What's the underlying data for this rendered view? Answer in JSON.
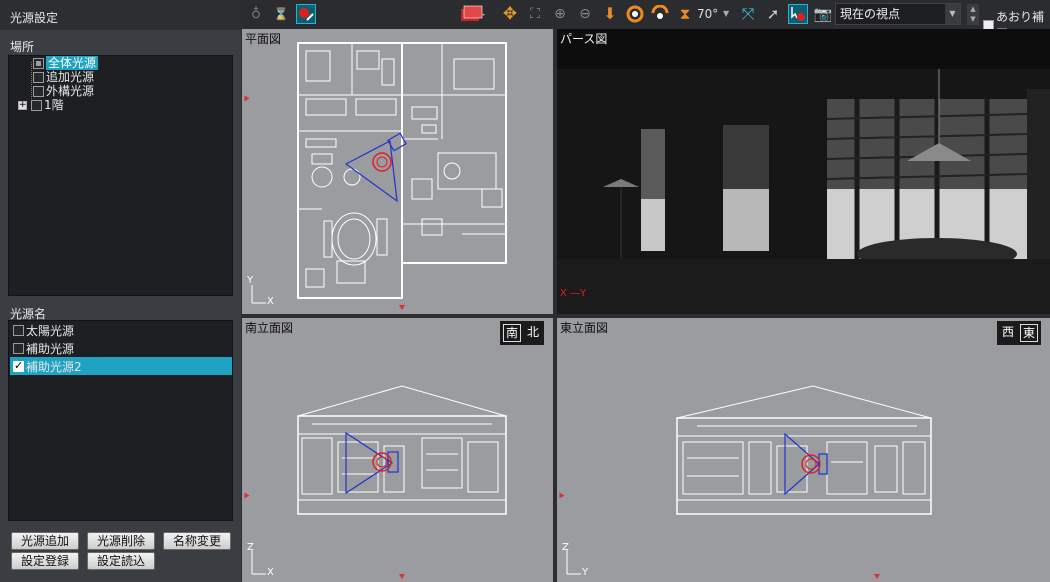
{
  "panel": {
    "title": "光源設定",
    "location_label": "場所",
    "tree": [
      {
        "label": "全体光源"
      },
      {
        "label": "追加光源"
      },
      {
        "label": "外構光源"
      },
      {
        "label": "1階"
      }
    ],
    "source_name_label": "光源名",
    "sources": [
      {
        "label": "太陽光源",
        "checked": false
      },
      {
        "label": "補助光源",
        "checked": false
      },
      {
        "label": "補助光源2",
        "checked": true
      }
    ],
    "buttons": {
      "add": "光源追加",
      "delete": "光源削除",
      "rename": "名称変更",
      "save": "設定登録",
      "load": "設定読込"
    }
  },
  "toolbar": {
    "fov": "70°",
    "viewpoint": "現在の視点",
    "tilt_label": "あおり補正",
    "tilt_checked": false
  },
  "viewports": {
    "plan": {
      "title": "平面図",
      "axis_y": "Y",
      "axis_x": "X"
    },
    "perspective": {
      "title": "パース図",
      "axis_label": "X ―Y"
    },
    "south": {
      "title": "南立面図",
      "dir_a": "南",
      "dir_b": "北",
      "axis_y": "Z",
      "axis_x": "X"
    },
    "east": {
      "title": "東立面図",
      "dir_a": "西",
      "dir_b": "東",
      "axis_y": "Z",
      "axis_x": "Y"
    }
  },
  "colors": {
    "accent": "#1ea3c4",
    "viewport_bg": "#9a9c9f",
    "light_marker": "#e02020",
    "light_cone": "#2233cc"
  }
}
